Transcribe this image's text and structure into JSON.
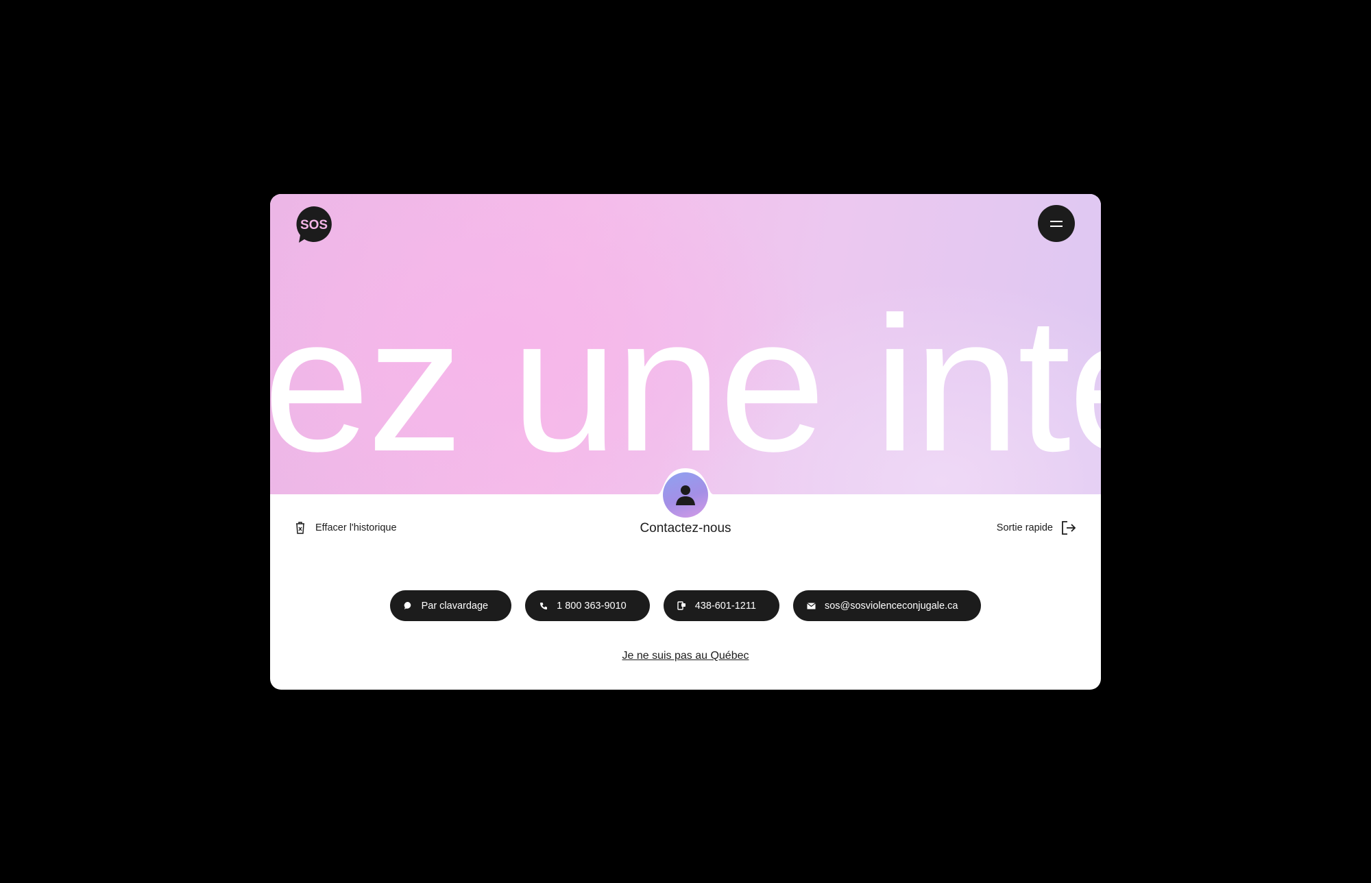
{
  "logo": {
    "text": "SOS"
  },
  "menu": {
    "icon": "menu-icon"
  },
  "hero": {
    "text": "ez une inte"
  },
  "contact": {
    "title": "Contactez-nous",
    "avatar_icon": "person-icon"
  },
  "actions": {
    "clear_history": {
      "label": "Effacer l'historique",
      "icon": "trash-icon"
    },
    "quick_exit": {
      "label": "Sortie rapide",
      "icon": "exit-icon"
    }
  },
  "channels": [
    {
      "label": "Par clavardage",
      "icon": "chat-icon"
    },
    {
      "label": "1 800 363-9010",
      "icon": "phone-icon"
    },
    {
      "label": "438-601-1211",
      "icon": "sms-icon"
    },
    {
      "label": "sos@sosviolenceconjugale.ca",
      "icon": "mail-icon"
    }
  ],
  "location_link": "Je ne suis pas au Québec",
  "colors": {
    "background": "#000000",
    "card": "#ffffff",
    "dark": "#1c1c1c",
    "hero_pink": "#f5bdea",
    "hero_lilac": "#ddc8f2"
  }
}
